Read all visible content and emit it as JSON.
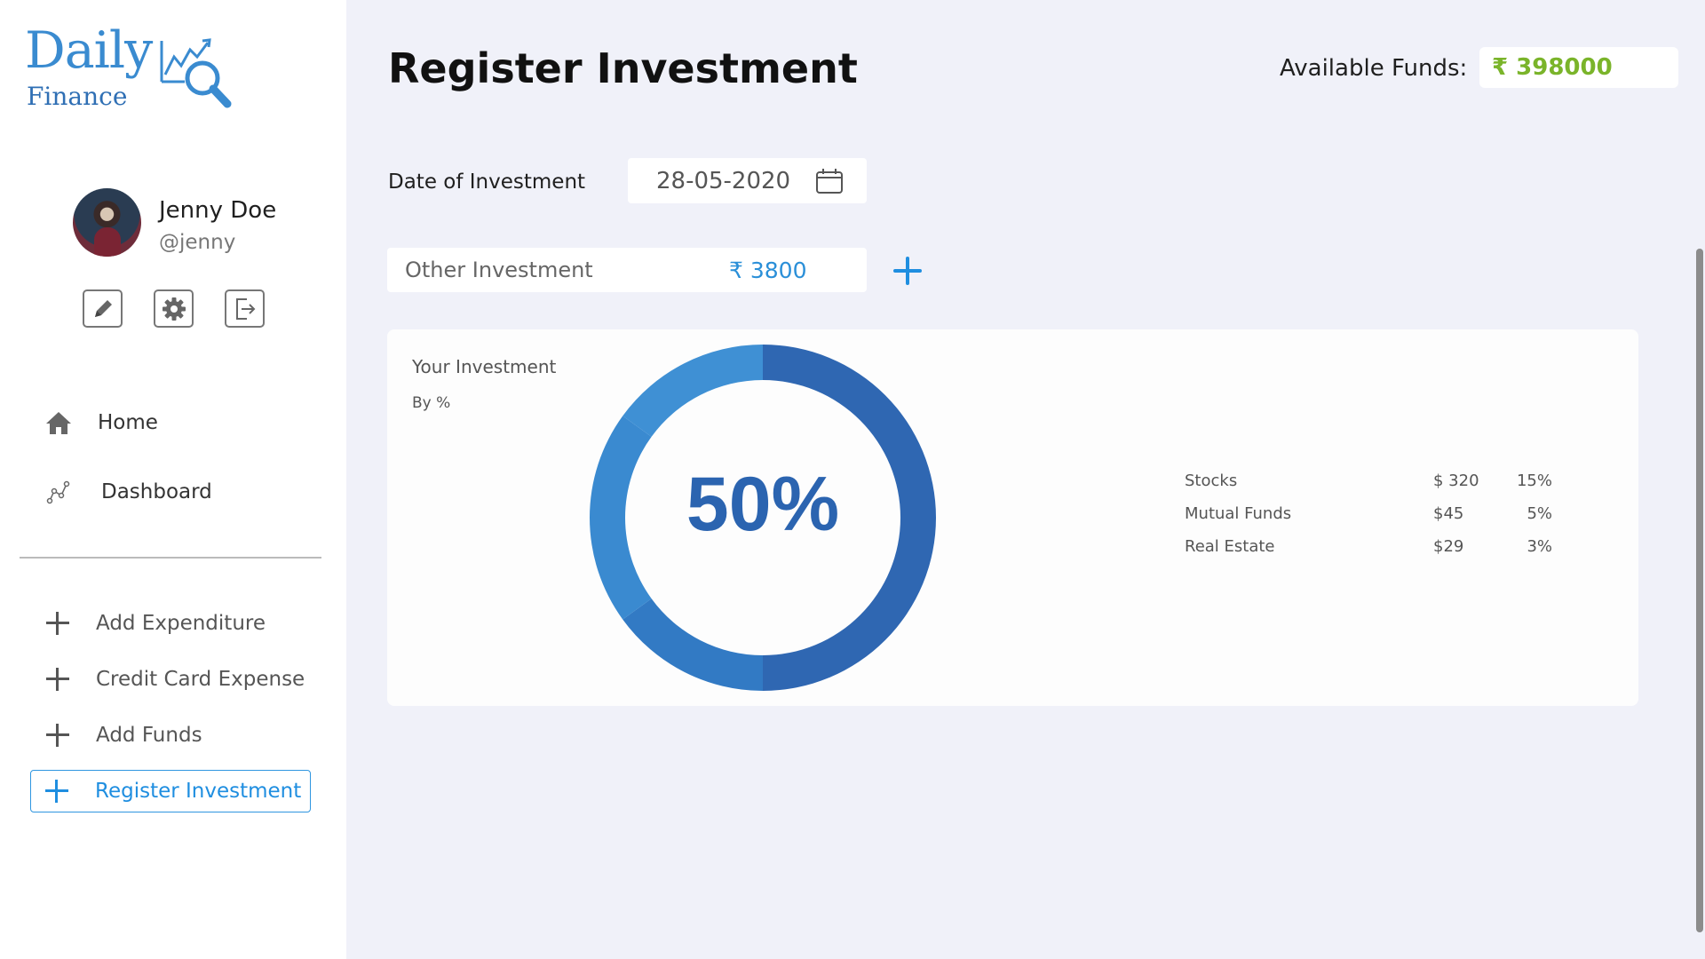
{
  "app": {
    "logo_daily": "Daily",
    "logo_finance": "Finance",
    "logo_icon": "chart-magnifier-icon"
  },
  "profile": {
    "name": "Jenny Doe",
    "handle": "@jenny",
    "actions": [
      "edit-icon",
      "gear-icon",
      "logout-icon"
    ]
  },
  "nav": {
    "home": "Home",
    "dashboard": "Dashboard"
  },
  "actions_menu": {
    "add_expenditure": "Add Expenditure",
    "credit_card_expense": "Credit Card Expense",
    "add_funds": "Add Funds",
    "register_investment": "Register Investment"
  },
  "header": {
    "title": "Register Investment",
    "funds_label": "Available Funds:",
    "funds_value": "₹ 398000"
  },
  "form": {
    "date_label": "Date of Investment",
    "date_value": "28-05-2020",
    "other_label": "Other Investment",
    "other_value": "₹ 3800"
  },
  "card": {
    "title": "Your Investment",
    "subtitle": "By %",
    "center_text": "50%"
  },
  "chart_data": {
    "type": "pie",
    "donut": true,
    "center_label": "50%",
    "slices": [
      {
        "value": 50,
        "color": "#2f67b2"
      },
      {
        "value": 15,
        "color": "#327ac4"
      },
      {
        "value": 20,
        "color": "#3a8ad0"
      },
      {
        "value": 15,
        "color": "#3f90d4"
      }
    ],
    "table": [
      {
        "name": "Stocks",
        "amount": "$ 320",
        "percent": "15%"
      },
      {
        "name": "Mutual Funds",
        "amount": "$45",
        "percent": "5%"
      },
      {
        "name": "Real Estate",
        "amount": "$29",
        "percent": "3%"
      }
    ]
  },
  "colors": {
    "accent": "#1f8ee0",
    "funds": "#7ab42a",
    "background": "#f0f1f9"
  }
}
